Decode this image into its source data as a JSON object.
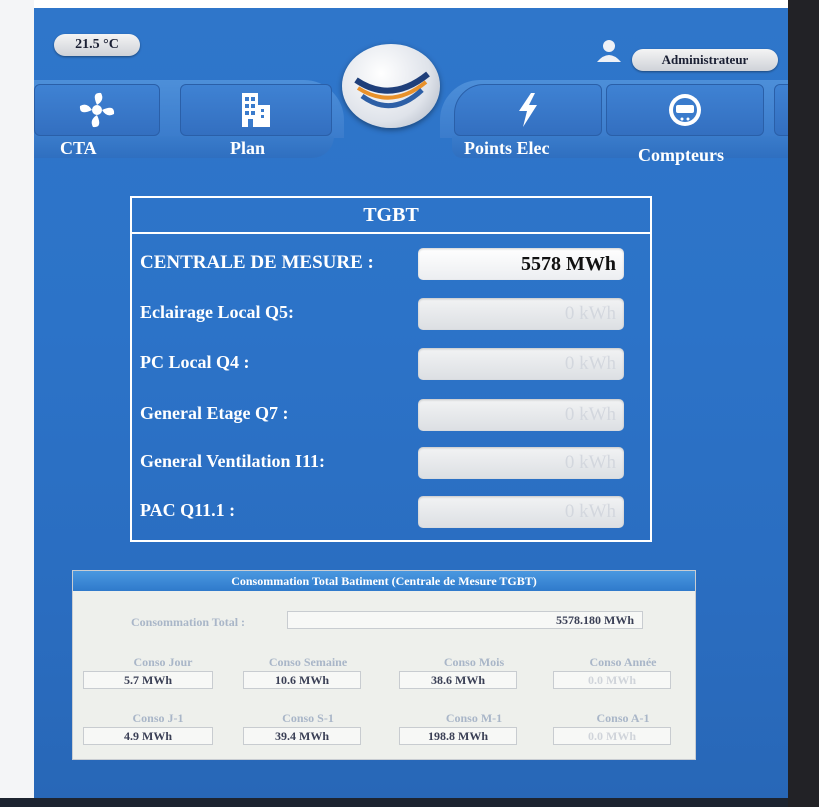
{
  "header": {
    "temperature": "21.5 °C",
    "user": "Administrateur",
    "tabs": [
      {
        "label": "CTA",
        "icon": "fan-icon"
      },
      {
        "label": "Plan",
        "icon": "building-icon"
      },
      {
        "label": "Points Elec",
        "icon": "lightning-icon"
      },
      {
        "label": "Compteurs",
        "icon": "meter-icon"
      }
    ]
  },
  "tgbt": {
    "title": "TGBT",
    "rows": [
      {
        "label": "CENTRALE DE MESURE :",
        "value": "5578 MWh"
      },
      {
        "label": "Eclairage Local Q5:",
        "value": "0 kWh"
      },
      {
        "label": "PC Local Q4 :",
        "value": "0 kWh"
      },
      {
        "label": "General Etage Q7 :",
        "value": "0 kWh"
      },
      {
        "label": "General Ventilation I11:",
        "value": "0 kWh"
      },
      {
        "label": "PAC Q11.1 :",
        "value": "0 kWh"
      }
    ]
  },
  "consommation": {
    "title": "Consommation Total Batiment (Centrale de Mesure TGBT)",
    "total_label": "Consommation Total :",
    "total_value": "5578.180 MWh",
    "cells": [
      {
        "label": "Conso Jour",
        "value": "5.7 MWh"
      },
      {
        "label": "Conso Semaine",
        "value": "10.6 MWh"
      },
      {
        "label": "Conso Mois",
        "value": "38.6 MWh"
      },
      {
        "label": "Conso Année",
        "value": "0.0 MWh"
      },
      {
        "label": "Conso J-1",
        "value": "4.9 MWh"
      },
      {
        "label": "Conso S-1",
        "value": "39.4 MWh"
      },
      {
        "label": "Conso M-1",
        "value": "198.8 MWh"
      },
      {
        "label": "Conso A-1",
        "value": "0.0 MWh"
      }
    ]
  },
  "colors": {
    "background": "#2c73c8",
    "panel_border": "#ffffff",
    "value_text": "#111111",
    "dim_text": "#d3d7de"
  }
}
